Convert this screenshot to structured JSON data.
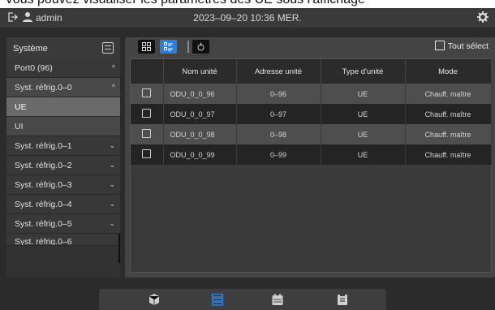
{
  "caption": "Vous pouvez visualiser les paramètres des UE sous l'affichage",
  "topbar": {
    "user": "admin",
    "datetime": "2023–09–20 10:36 MER."
  },
  "sidebar": {
    "title": "Système",
    "items": [
      {
        "label": "Port0 (96)",
        "chevron": "^"
      },
      {
        "label": "Syst. réfrig.0–0",
        "chevron": "^"
      },
      {
        "label": "UE",
        "chevron": ""
      },
      {
        "label": "UI",
        "chevron": ""
      },
      {
        "label": "Syst. réfrig.0–1",
        "chevron": "⌄"
      },
      {
        "label": "Syst. réfrig.0–2",
        "chevron": "⌄"
      },
      {
        "label": "Syst. réfrig.0–3",
        "chevron": "⌄"
      },
      {
        "label": "Syst. réfrig.0–4",
        "chevron": "⌄"
      },
      {
        "label": "Syst. réfrig.0–5",
        "chevron": "⌄"
      },
      {
        "label": "Syst. réfrig.0–6",
        "chevron": ""
      }
    ]
  },
  "toolbar": {
    "select_all": "Tout sélect"
  },
  "table": {
    "headers": [
      "",
      "Nom unité",
      "Adresse unité",
      "Type d'unité",
      "Mode"
    ],
    "rows": [
      {
        "name": "ODU_0_0_96",
        "address": "0–96",
        "type": "UE",
        "mode": "Chauff. maître"
      },
      {
        "name": "ODU_0_0_97",
        "address": "0–97",
        "type": "UE",
        "mode": "Chauff. maître"
      },
      {
        "name": "ODU_0_0_98",
        "address": "0–98",
        "type": "UE",
        "mode": "Chauff. maître"
      },
      {
        "name": "ODU_0_0_99",
        "address": "0–99",
        "type": "UE",
        "mode": "Chauff. maître"
      }
    ]
  },
  "bottom_nav": [
    "cube-icon",
    "list-icon",
    "calendar-icon",
    "clipboard-icon"
  ],
  "colors": {
    "accent": "#2a7fe0",
    "background": "#2b2b2b",
    "panel": "#444444"
  }
}
